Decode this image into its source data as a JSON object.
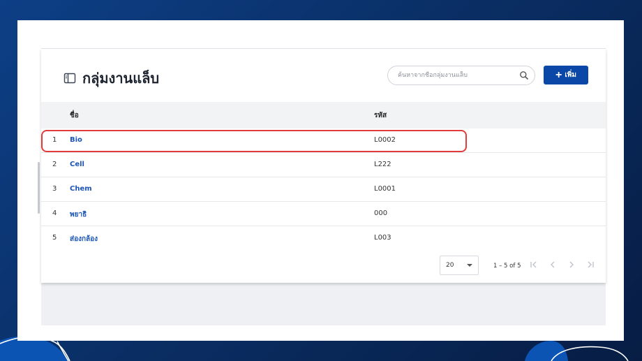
{
  "page": {
    "title": "กลุ่มงานแล็บ"
  },
  "search": {
    "placeholder": "ค้นหาจากชื่อกลุ่มงานแล็บ"
  },
  "add_button": {
    "label": "เพิ่ม"
  },
  "table": {
    "columns": {
      "name": "ชื่อ",
      "code": "รหัส"
    },
    "rows": [
      {
        "index": "1",
        "name": "Bio",
        "code": "L0002"
      },
      {
        "index": "2",
        "name": "Cell",
        "code": "L222"
      },
      {
        "index": "3",
        "name": "Chem",
        "code": "L0001"
      },
      {
        "index": "4",
        "name": "พยาธิ",
        "code": "000"
      },
      {
        "index": "5",
        "name": "ส่องกล้อง",
        "code": "L003"
      }
    ]
  },
  "pagination": {
    "page_size": "20",
    "range": "1 – 5 of 5"
  },
  "colors": {
    "primary": "#0a47a6",
    "link": "#1a54b8",
    "highlight": "#e23b3b",
    "background": "#0a2f66"
  },
  "icons": {
    "title": "sidebar-panel-icon",
    "search": "search-icon",
    "add": "plus-icon",
    "first": "first-page-icon",
    "prev": "chevron-left-icon",
    "next": "chevron-right-icon",
    "last": "last-page-icon"
  }
}
